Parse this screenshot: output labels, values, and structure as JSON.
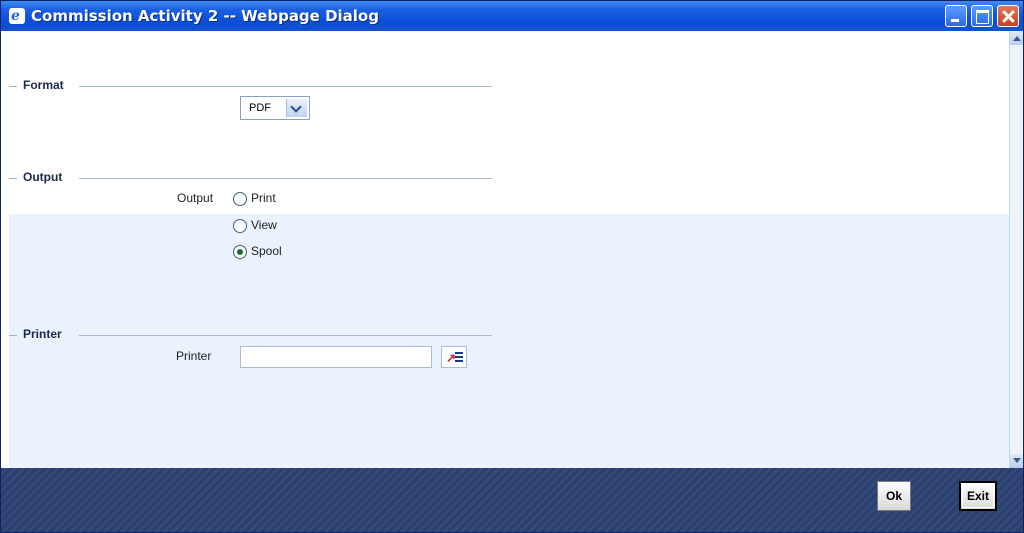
{
  "window": {
    "title": "Commission Activity 2 -- Webpage Dialog",
    "icon": "ie-icon"
  },
  "format": {
    "legend": "Format",
    "select": {
      "value": "PDF"
    }
  },
  "output": {
    "legend": "Output",
    "field_label": "Output",
    "options": [
      {
        "label": "Print",
        "checked": false
      },
      {
        "label": "View",
        "checked": false
      },
      {
        "label": "Spool",
        "checked": true
      }
    ]
  },
  "printer": {
    "legend": "Printer",
    "field_label": "Printer",
    "value": ""
  },
  "footer": {
    "ok_label": "Ok",
    "exit_label": "Exit"
  },
  "colors": {
    "titlebar": "#0a4ed8",
    "footer": "#2a3f6c",
    "lower_panel": "#e9f2fd"
  }
}
